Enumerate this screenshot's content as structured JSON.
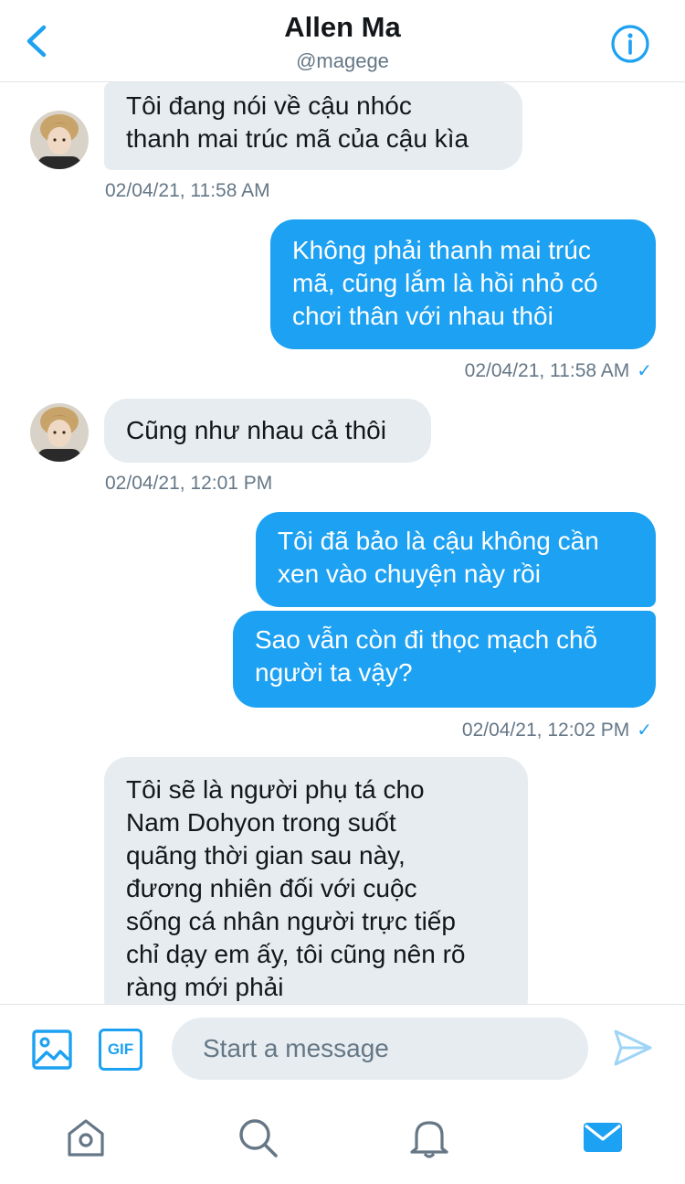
{
  "header": {
    "title": "Allen Ma",
    "handle": "@magege",
    "back_icon": "chevron-left-icon",
    "info_icon": "info-icon"
  },
  "messages": [
    {
      "from": "them",
      "text": "Tôi đang nói về cậu nhóc\nthanh mai trúc mã của cậu kìa",
      "time": "02/04/21, 11:58 AM"
    },
    {
      "from": "me",
      "text": "Không phải thanh mai trúc\nmã, cũng lắm là hồi nhỏ có\nchơi thân với nhau thôi",
      "time": "02/04/21, 11:58 AM"
    },
    {
      "from": "them",
      "text": "Cũng như nhau cả thôi",
      "time": "02/04/21, 12:01 PM"
    },
    {
      "from": "me",
      "text": "Tôi đã bảo là cậu không cần\nxen vào chuyện này rồi"
    },
    {
      "from": "me",
      "text": "Sao vẫn còn đi thọc mạch chỗ\nngười ta vậy?",
      "time": "02/04/21, 12:02 PM"
    },
    {
      "from": "them",
      "text": "Tôi sẽ là người phụ tá cho\nNam Dohyon trong suốt\nquãng thời gian sau này,\nđương nhiên đối với cuộc\nsống cá nhân người trực tiếp\nchỉ dạy em ấy, tôi cũng nên rõ\nràng mới phải"
    }
  ],
  "read_mark": "✓",
  "composer": {
    "placeholder": "Start a message",
    "gif_label": "GIF",
    "media_icon": "image-icon",
    "send_icon": "send-icon"
  },
  "tabbar": {
    "items": [
      "home-icon",
      "search-icon",
      "bell-icon",
      "mail-icon"
    ],
    "active": "mail-icon"
  },
  "colors": {
    "accent": "#1da1f2",
    "incoming_bubble": "#e6ecf0",
    "muted_text": "#657786"
  }
}
